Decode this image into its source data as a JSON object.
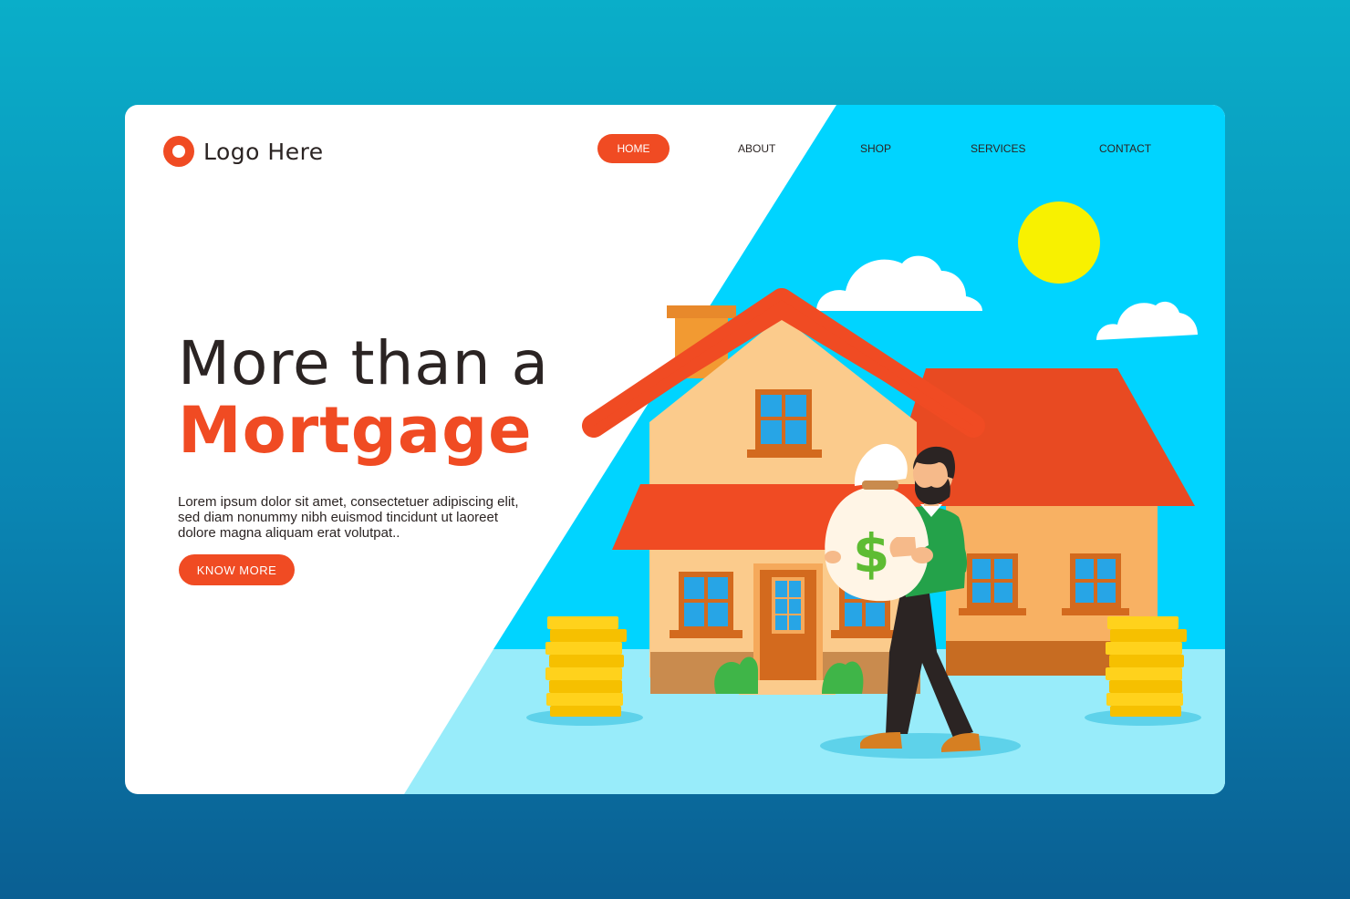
{
  "logo": {
    "text": "Logo Here"
  },
  "nav": {
    "home": "HOME",
    "about": "ABOUT",
    "shop": "SHOP",
    "services": "SERVICES",
    "contact": "CONTACT"
  },
  "hero": {
    "title_line1": "More than a",
    "title_line2": "Mortgage",
    "description": "Lorem ipsum dolor sit amet, consectetuer adipiscing elit, sed diam nonummy nibh euismod tincidunt ut laoreet dolore magna aliquam erat volutpat..",
    "button_label": "KNOW MORE"
  },
  "illustration": {
    "money_symbol": "$"
  },
  "colors": {
    "accent": "#f04b23",
    "sky": "#00d4ff",
    "ground": "#98ecfa",
    "text_dark": "#2b2423",
    "sun": "#f8f100",
    "coin": "#ffd21c",
    "shirt": "#24a24a"
  }
}
